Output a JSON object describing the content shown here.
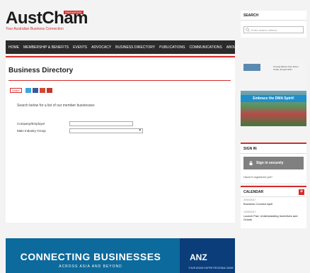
{
  "header": {
    "logo_text": "AustCham",
    "logo_tag": "Singapore",
    "tagline": "Your Australian Business Connection"
  },
  "nav": {
    "items": [
      "Home",
      "Membership & Benefits",
      "Events",
      "Advocacy",
      "Business Directory",
      "Publications",
      "Communications",
      "About"
    ]
  },
  "main": {
    "title": "Business Directory",
    "share_label": "Share",
    "intro": "Search below for a list of our member businesses",
    "form": {
      "company_label": "Company/Employer",
      "company_value": "",
      "industry_label": "Main Industry Group",
      "industry_value": ""
    }
  },
  "banner": {
    "headline": "CONNECTING BUSINESSES",
    "subline": "ACROSS ASIA AND BEYOND",
    "anz_logo": "ANZ",
    "anz_sub": "YOUR ASIAN SUPER REGIONAL BANK"
  },
  "sidebar": {
    "search": {
      "heading": "Search",
      "placeholder": "Enter search criteria"
    },
    "ad": {
      "band_text": "Embrace the DMA Spirit!",
      "top_text": "Coming Miners from Down Under, 22 April 2017"
    },
    "signin": {
      "heading": "Sign In",
      "button": "Sign in securely",
      "register": "Haven't registered yet?"
    },
    "calendar": {
      "heading": "Calendar",
      "events": [
        {
          "date": "20/04/2017",
          "title": "Business Connect April"
        },
        {
          "date": "12/05/2017",
          "title": "Launch Pad: Understanding Incentives and Grants"
        }
      ]
    }
  },
  "colors": {
    "accent": "#d52b2b",
    "nav_bg": "#2b2b2b",
    "banner_bg": "#0d6a9c",
    "anz_bg": "#0a3d7a"
  }
}
